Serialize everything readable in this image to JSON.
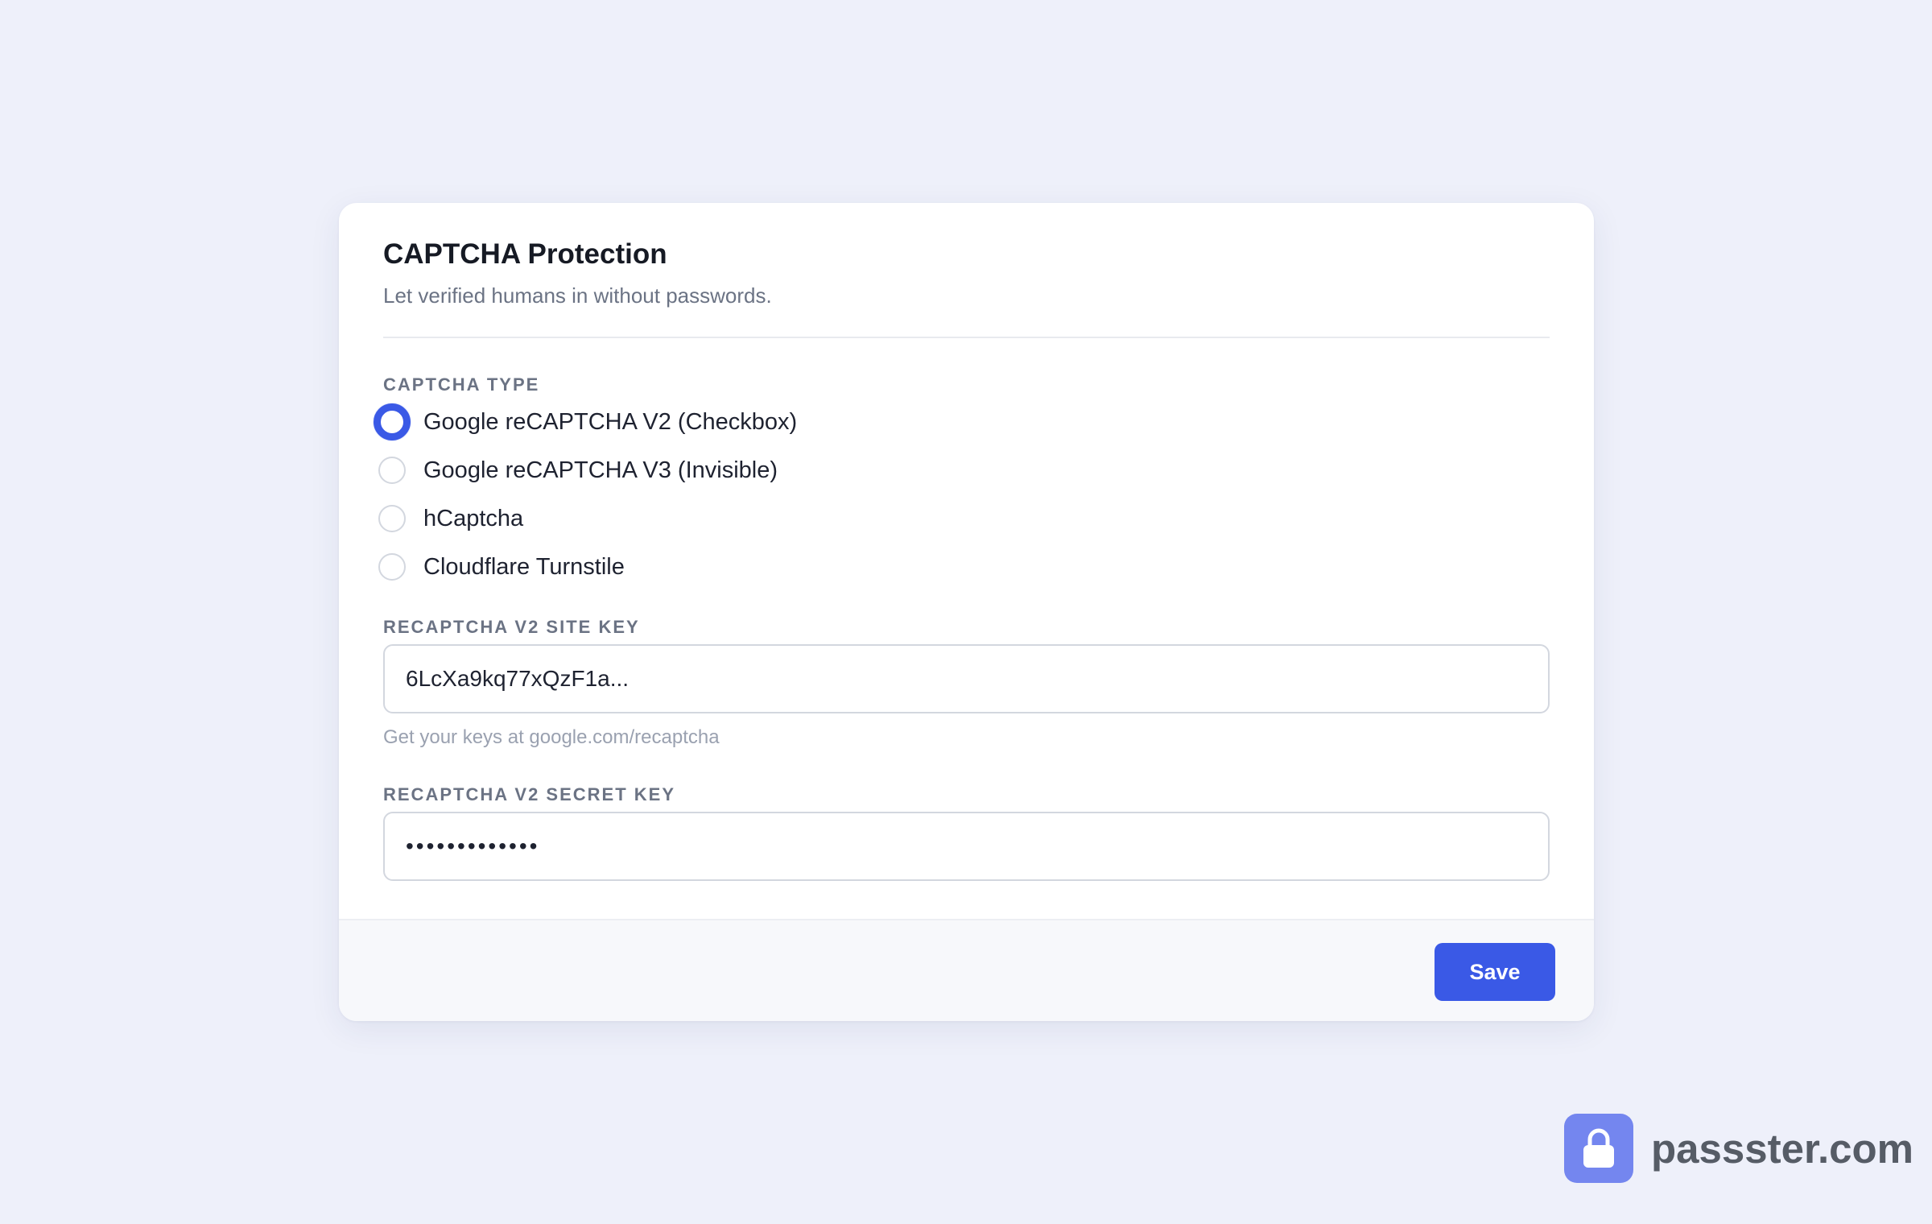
{
  "card": {
    "title": "CAPTCHA Protection",
    "subtitle": "Let verified humans in without passwords."
  },
  "captcha_type": {
    "label": "CAPTCHA TYPE",
    "selected": "Google reCAPTCHA V2 (Checkbox)",
    "options": [
      {
        "label": "Google reCAPTCHA V2 (Checkbox)",
        "checked": true
      },
      {
        "label": "Google reCAPTCHA V3 (Invisible)",
        "checked": false
      },
      {
        "label": "hCaptcha",
        "checked": false
      },
      {
        "label": "Cloudflare Turnstile",
        "checked": false
      }
    ]
  },
  "site_key": {
    "label": "RECAPTCHA V2 SITE KEY",
    "value": "6LcXa9kq77xQzF1a...",
    "hint": "Get your keys at google.com/recaptcha"
  },
  "secret_key": {
    "label": "RECAPTCHA V2 SECRET KEY",
    "value": "•••••••••••••"
  },
  "footer": {
    "save_label": "Save"
  },
  "brand": {
    "name": "passster.com",
    "icon": "lock-icon"
  },
  "colors": {
    "background": "#eef0fa",
    "accent": "#3a59e6",
    "brand_logo": "#7486ef"
  }
}
